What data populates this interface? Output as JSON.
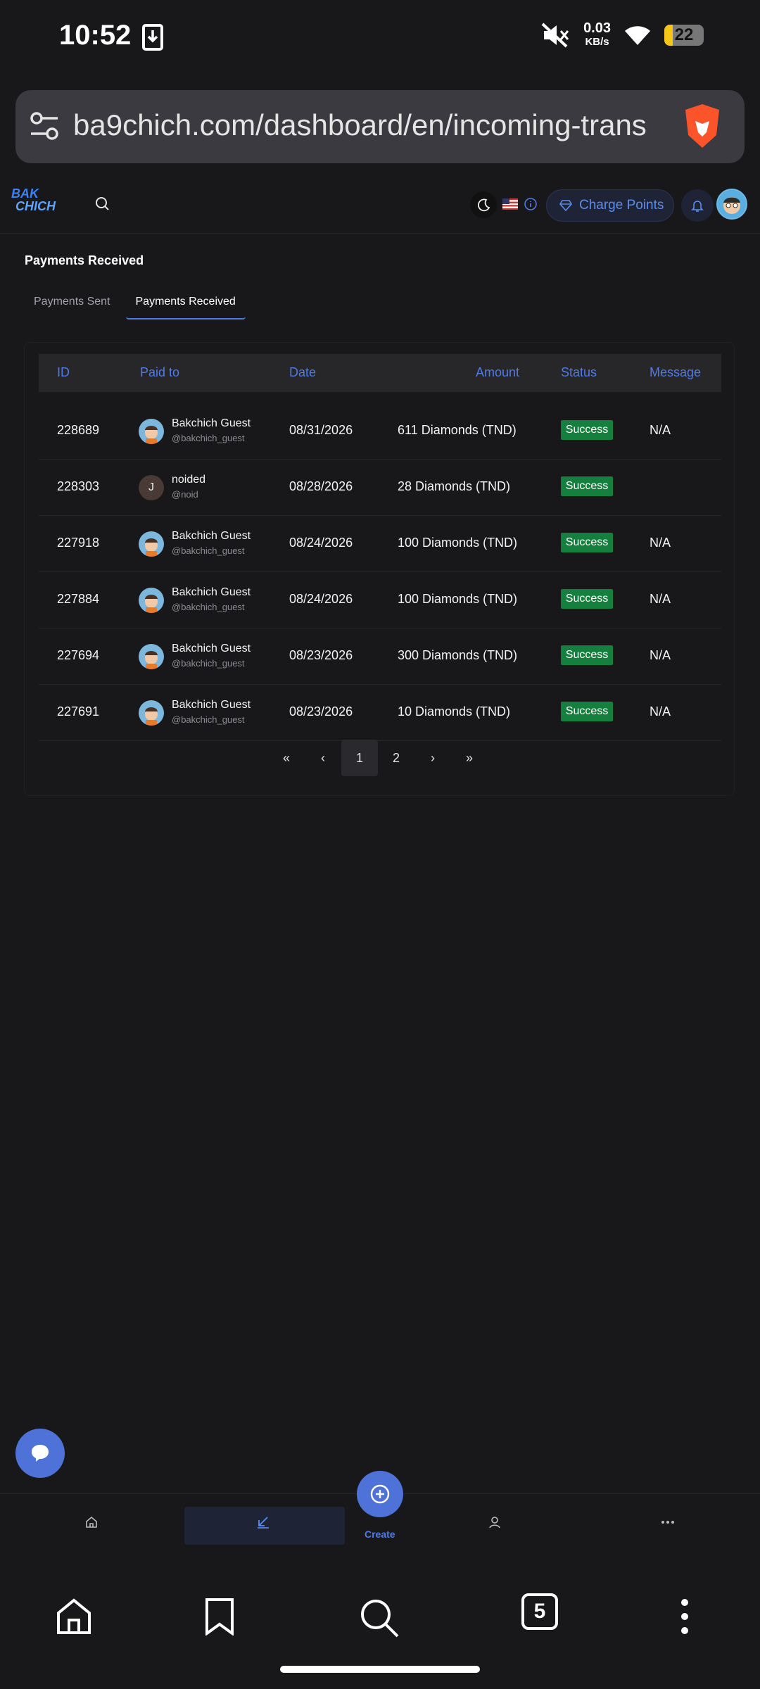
{
  "status": {
    "time": "10:52",
    "speed_value": "0.03",
    "speed_unit": "KB/s",
    "battery": "22",
    "battery_level": 0.22
  },
  "browser": {
    "url": "ba9chich.com/dashboard/en/incoming-trans",
    "tab_count": "5"
  },
  "header": {
    "logo_line1": "BAK",
    "logo_line2": "CHICH",
    "charge_label": "Charge Points"
  },
  "page": {
    "title": "Payments Received",
    "tabs": [
      {
        "label": "Payments Sent"
      },
      {
        "label": "Payments Received"
      }
    ]
  },
  "table": {
    "columns": {
      "id": "ID",
      "paid_to": "Paid to",
      "date": "Date",
      "amount": "Amount",
      "status": "Status",
      "message": "Message"
    },
    "rows": [
      {
        "id": "228689",
        "name": "Bakchich Guest",
        "handle": "@bakchich_guest",
        "date": "08/31/2026",
        "amount": "611 Diamonds (TND)",
        "status": "Success",
        "message": "N/A"
      },
      {
        "id": "228303",
        "name": "noided",
        "handle": "@noid",
        "initial": "J",
        "date": "08/28/2026",
        "amount": "28 Diamonds (TND)",
        "status": "Success",
        "message": ""
      },
      {
        "id": "227918",
        "name": "Bakchich Guest",
        "handle": "@bakchich_guest",
        "date": "08/24/2026",
        "amount": "100 Diamonds (TND)",
        "status": "Success",
        "message": "N/A"
      },
      {
        "id": "227884",
        "name": "Bakchich Guest",
        "handle": "@bakchich_guest",
        "date": "08/24/2026",
        "amount": "100 Diamonds (TND)",
        "status": "Success",
        "message": "N/A"
      },
      {
        "id": "227694",
        "name": "Bakchich Guest",
        "handle": "@bakchich_guest",
        "date": "08/23/2026",
        "amount": "300 Diamonds (TND)",
        "status": "Success",
        "message": "N/A"
      },
      {
        "id": "227691",
        "name": "Bakchich Guest",
        "handle": "@bakchich_guest",
        "date": "08/23/2026",
        "amount": "10 Diamonds (TND)",
        "status": "Success",
        "message": "N/A"
      }
    ]
  },
  "pagination": {
    "first": "«",
    "prev": "‹",
    "pages": [
      "1",
      "2"
    ],
    "current": "1",
    "next": "›",
    "last": "»"
  },
  "appnav": {
    "create_label": "Create"
  },
  "colors": {
    "accent": "#4f7be8",
    "success": "#15803d",
    "background": "#18181b"
  }
}
